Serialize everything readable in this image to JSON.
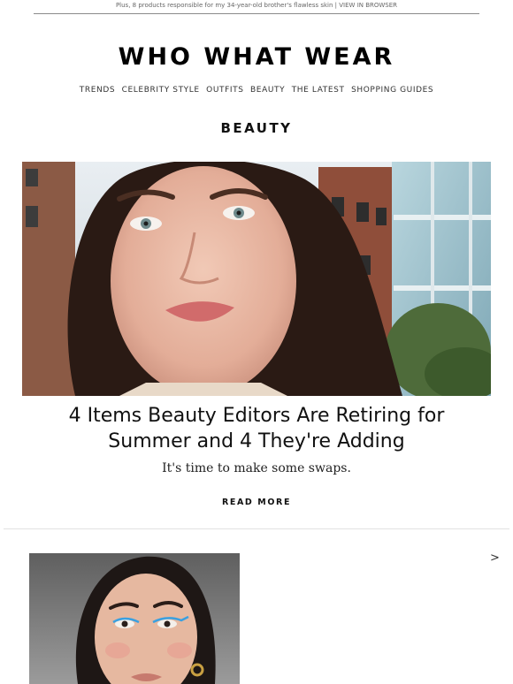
{
  "preheader": {
    "text": "Plus, 8 products responsible for my 34-year-old brother's flawless skin",
    "separator": "|",
    "link": "VIEW IN BROWSER"
  },
  "brand": {
    "logo": "WHO WHAT WEAR"
  },
  "nav": {
    "items": [
      "TRENDS",
      "CELEBRITY STYLE",
      "OUTFITS",
      "BEAUTY",
      "THE LATEST",
      "SHOPPING GUIDES"
    ]
  },
  "section": {
    "title": "BEAUTY"
  },
  "feature": {
    "image_icon": "portrait-photo",
    "headline_line1": "4 Items Beauty Editors Are Retiring for",
    "headline_line2": "Summer and 4 They're Adding",
    "dek": "It's time to make some swaps.",
    "cta": "READ MORE"
  },
  "next_story": {
    "image_icon": "portrait-photo",
    "arrow": ">"
  }
}
